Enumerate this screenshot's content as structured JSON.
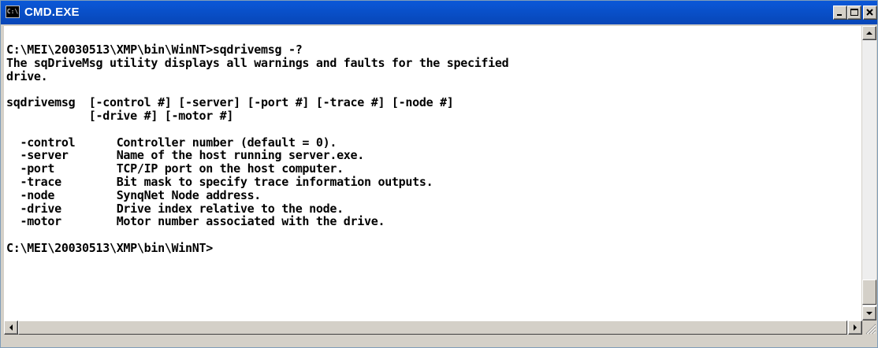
{
  "window": {
    "title": "CMD.EXE",
    "icon_name": "cmd-icon",
    "icon_text": "C:\\",
    "title_bar_color": "#0a58d8"
  },
  "controls": {
    "minimize_icon": "minimize-icon",
    "maximize_icon": "maximize-icon",
    "close_icon": "close-icon"
  },
  "console": {
    "background": "#ffffff",
    "foreground": "#000000",
    "lines": [
      "C:\\MEI\\20030513\\XMP\\bin\\WinNT>sqdrivemsg -?",
      "The sqDriveMsg utility displays all warnings and faults for the specified",
      "drive.",
      "",
      "sqdrivemsg  [-control #] [-server] [-port #] [-trace #] [-node #]",
      "            [-drive #] [-motor #]",
      "",
      "  -control      Controller number (default = 0).",
      "  -server       Name of the host running server.exe.",
      "  -port         TCP/IP port on the host computer.",
      "  -trace        Bit mask to specify trace information outputs.",
      "  -node         SynqNet Node address.",
      "  -drive        Drive index relative to the node.",
      "  -motor        Motor number associated with the drive.",
      "",
      "C:\\MEI\\20030513\\XMP\\bin\\WinNT>"
    ]
  },
  "scrollbars": {
    "up_icon": "arrow-up-icon",
    "down_icon": "arrow-down-icon",
    "left_icon": "arrow-left-icon",
    "right_icon": "arrow-right-icon",
    "resize_icon": "resize-grip-icon"
  }
}
